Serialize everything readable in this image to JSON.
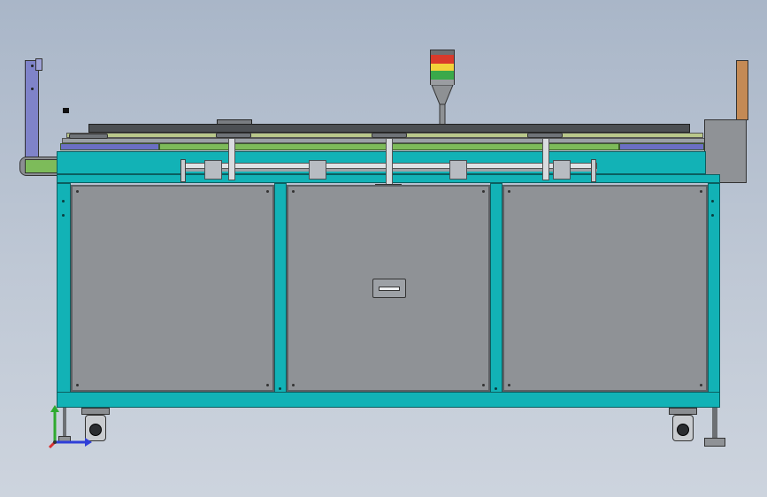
{
  "viewport": {
    "background_top": "#a9b6c8",
    "background_bottom": "#cdd4de"
  },
  "model": {
    "frame_color": "#12b2b6",
    "panel_color": "#8f9296",
    "conveyor_belt_colors": [
      "#6b6fc4",
      "#7dbb5a"
    ],
    "stack_light_colors": [
      "#d93a2b",
      "#f2d23a",
      "#3aa94a"
    ],
    "left_panel_color": "#7f83c9",
    "right_bar_color": "#c48a55"
  },
  "triad": {
    "x_color": "#2f3ed8",
    "y_color": "#2faa2f",
    "z_color": "#d82f2f"
  }
}
